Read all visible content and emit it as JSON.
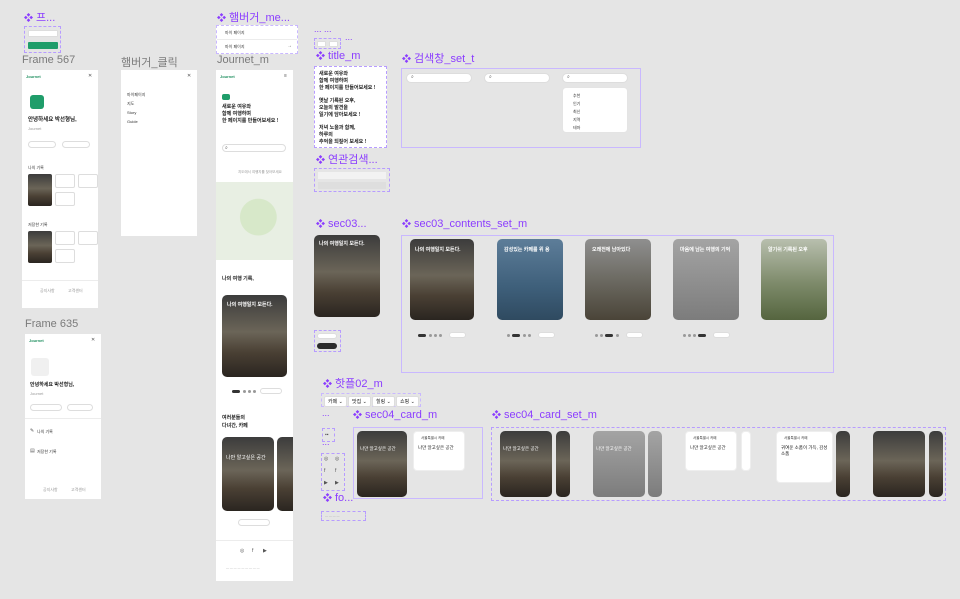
{
  "labels": {
    "frame567": "Frame 567",
    "hamburger_click": "햄버거_클릭",
    "journet_m": "Journet_m",
    "frame635": "Frame 635",
    "hamburger_me": "햄버거_me...",
    "title_m": "title_m",
    "search_set_t": "검색창_set_t",
    "related_search": "연관검색...",
    "sec03": "sec03...",
    "sec03_contents_set_m": "sec03_contents_set_m",
    "hotplace02_m": "핫플02_m",
    "sec04_card_m": "sec04_card_m",
    "sec04_card_set_m": "sec04_card_set_m",
    "fo": "fo...",
    "peu": "프...",
    "dots1": "... ...",
    "dots2": "...",
    "dots3": "...",
    "dots4": "..."
  },
  "frame567": {
    "brand": "Journet",
    "greeting": "안녕하세요 박선형님,",
    "subtext": "Journet",
    "btn1": "프로필 수정하기",
    "btn2": "로그아웃",
    "sec1": "나의 기록",
    "sec2": "저장한 기록",
    "foot1": "공지사항",
    "foot2": "고객센터"
  },
  "hamburger_menu": {
    "items": [
      "마이페이지",
      "지도",
      "Story",
      "Guide"
    ]
  },
  "hamburger_me_items": [
    "마이 페이지",
    "마이 페이지"
  ],
  "journet_m": {
    "brand": "Journet",
    "headline": [
      "새로운 여유와",
      "함께 여행하며",
      "한 페이지를 만들어보세요 !"
    ],
    "search_placeholder": "검색어를 입력해주세요",
    "map_caption": "지도에서 여행지를 찾아보세요",
    "sec_title": "나의 여행 기록,",
    "card_title": "나의 여행일지 모든다.",
    "sec4_title": "여러분들의",
    "sec4_sub": "다녀간, 카페",
    "card_title2": "나만 알고싶은 공간"
  },
  "title_m": {
    "lines": [
      "새로운 여유와",
      "함께 여행하며",
      "한 페이지를 만들어보세요 !",
      "옛날 기록된 오후,",
      "오늘의 발견을",
      "일기에 담아보세요 !",
      "저녁 노을과 함께,",
      "하루의",
      "추억을 되짚어 보세요 !"
    ]
  },
  "search_dropdown": [
    "추천",
    "인기",
    "최신",
    "지역",
    "테마"
  ],
  "sec03_cards": [
    {
      "title": "나의 여행일지 모든다.",
      "tag": "photo-street"
    },
    {
      "title": "나의 여행일지 모든다.",
      "tag": "photo-street"
    },
    {
      "title": "감성있는 카페를 위 용",
      "tag": "photo-blue"
    },
    {
      "title": "오래전에 남아있다",
      "tag": "photo-alley"
    },
    {
      "title": "마음에 남는 여행의 기억",
      "tag": "photo-grey"
    },
    {
      "title": "알기쉬 기록된 오후",
      "tag": "photo-green"
    }
  ],
  "hotplace_chips": [
    "카페",
    "맛집",
    "힐링",
    "쇼핑"
  ],
  "sec04_cards": {
    "title": "나만 알고싶은 공간",
    "small": "서울특별시 카페",
    "alt_title": "귀여운 소품이 가득, 감성소품"
  }
}
